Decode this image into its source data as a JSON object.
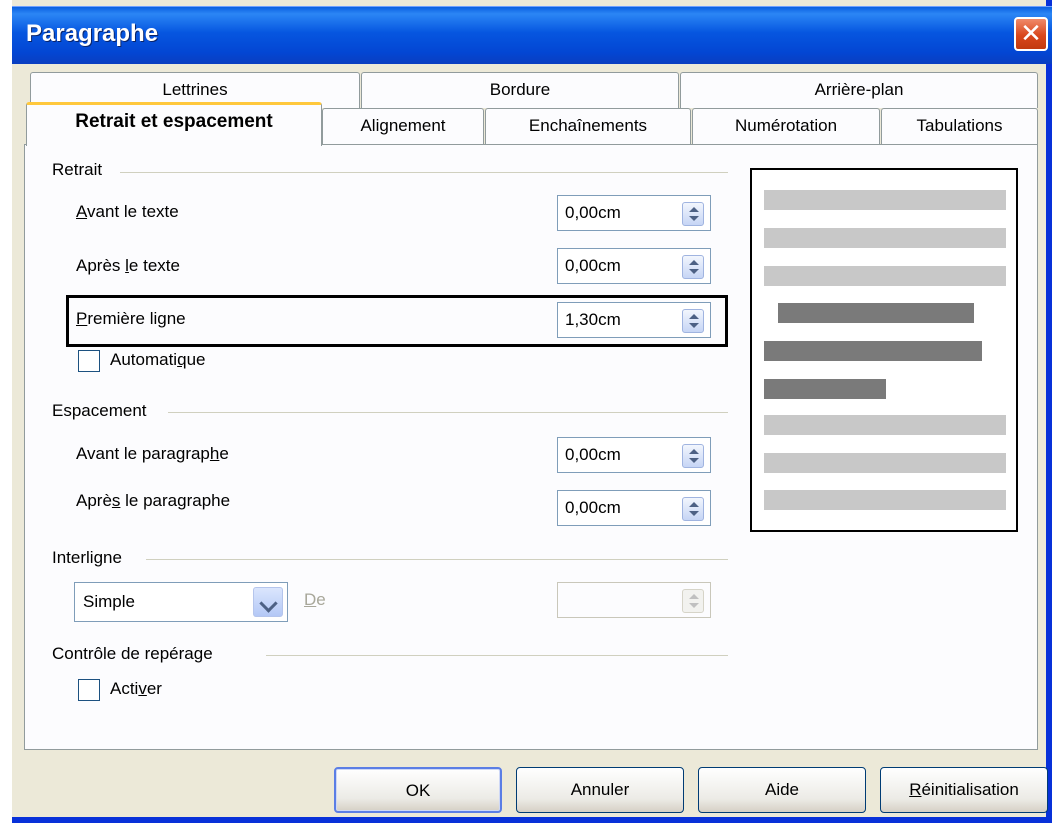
{
  "window": {
    "title": "Paragraphe",
    "close_icon": "close-icon"
  },
  "tabs_row1": [
    "Lettrines",
    "Bordure",
    "Arrière-plan"
  ],
  "tabs_row2": [
    "Retrait et espacement",
    "Alignement",
    "Enchaînements",
    "Numérotation",
    "Tabulations"
  ],
  "active_tab": "Retrait et espacement",
  "retrait": {
    "title": "Retrait",
    "avant_texte": {
      "label_pre": "",
      "label_u": "A",
      "label_post": "vant le texte",
      "value": "0,00cm"
    },
    "apres_texte": {
      "label_pre": "Après ",
      "label_u": "l",
      "label_post": "e texte",
      "value": "0,00cm"
    },
    "premiere_ligne": {
      "label_pre": "",
      "label_u": "P",
      "label_post": "remière ligne",
      "value": "1,30cm"
    },
    "automatique": {
      "label_pre": "Automati",
      "label_u": "q",
      "label_post": "ue",
      "checked": false
    }
  },
  "espacement": {
    "title": "Espacement",
    "avant_paragraphe": {
      "label_pre": "Avant le paragrap",
      "label_u": "h",
      "label_post": "e",
      "value": "0,00cm"
    },
    "apres_paragraphe": {
      "label_pre": "Aprè",
      "label_u": "s",
      "label_post": " le paragraphe",
      "value": "0,00cm"
    }
  },
  "interligne": {
    "title": "Interligne",
    "selected": "Simple",
    "de_label_u": "D",
    "de_label_post": "e",
    "de_value": ""
  },
  "controle": {
    "title": "Contrôle de repérage",
    "activer": {
      "label_pre": "Acti",
      "label_u": "v",
      "label_post": "er",
      "checked": false
    }
  },
  "buttons": {
    "ok": "OK",
    "cancel": "Annuler",
    "help": "Aide",
    "reset_u": "R",
    "reset_post": "éinitialisation"
  },
  "colors": {
    "title_bar": "#0a5fe0",
    "dialog_bg": "#ece9d8",
    "active_tab_accent": "#ffc83c",
    "preview_light": "#c8c8c8",
    "preview_dark": "#7a7a7a"
  }
}
